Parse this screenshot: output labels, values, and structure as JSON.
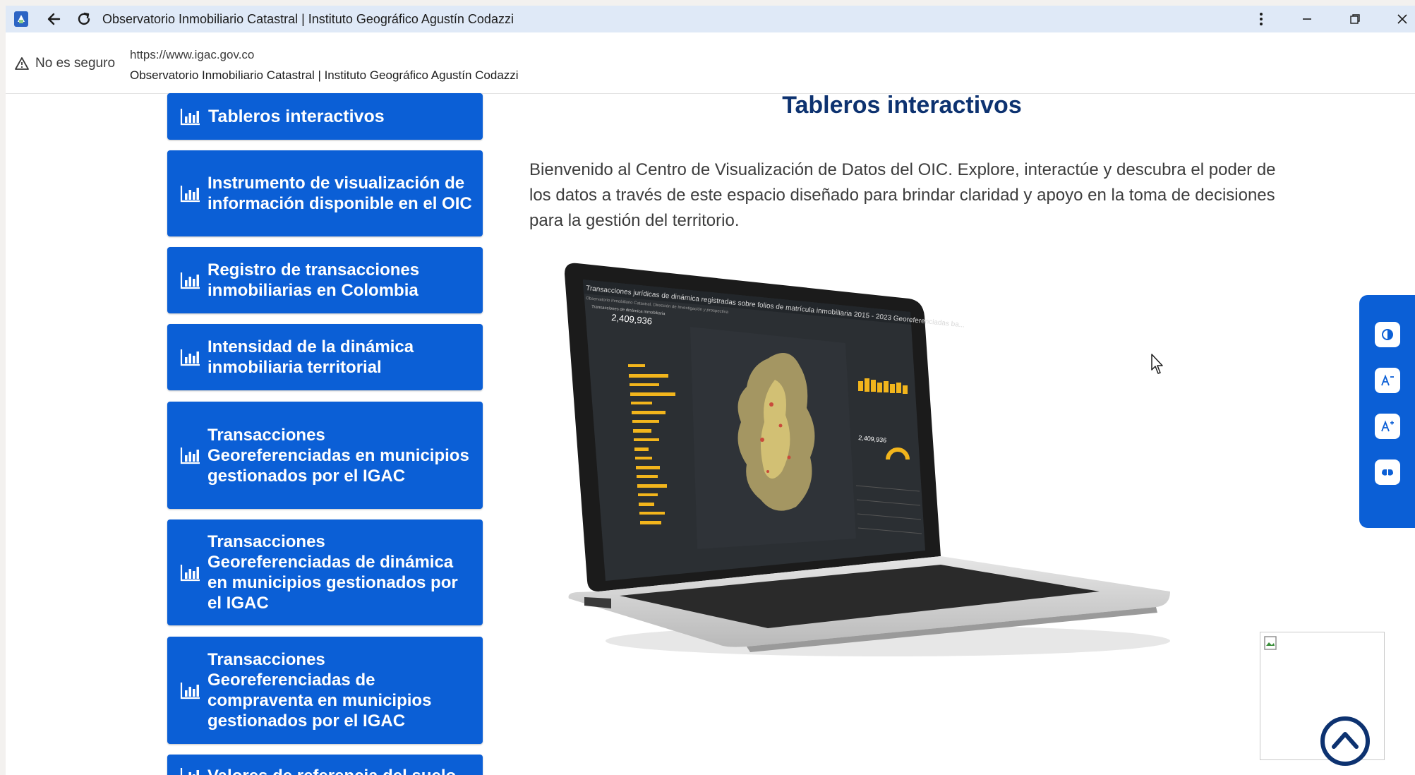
{
  "browser": {
    "title": "Observatorio Inmobiliario Catastral | Instituto Geográfico Agustín Codazzi",
    "security_label": "No es seguro",
    "url": "https://www.igac.gov.co",
    "page_title": "Observatorio Inmobiliario Catastral | Instituto Geográfico Agustín Codazzi"
  },
  "sidebar": {
    "items": [
      {
        "label": "Tableros interactivos"
      },
      {
        "label": "Instrumento de visualización de información disponible en el OIC"
      },
      {
        "label": "Registro de transacciones inmobiliarias en Colombia"
      },
      {
        "label": "Intensidad de la dinámica inmobiliaria territorial"
      },
      {
        "label": "Transacciones Georeferenciadas en municipios gestionados por el IGAC"
      },
      {
        "label": "Transacciones Georeferenciadas de dinámica en municipios gestionados por el IGAC"
      },
      {
        "label": "Transacciones Georeferenciadas de compraventa en municipios gestionados por el IGAC"
      },
      {
        "label": "Valores de referencia del suelo"
      }
    ]
  },
  "main": {
    "heading": "Tableros interactivos",
    "intro": "Bienvenido al Centro de Visualización de Datos del OIC. Explore, interactúe y descubra el poder de los datos a través de este espacio diseñado para brindar claridad y apoyo en la toma de decisiones para la gestión del territorio."
  },
  "dashboard_preview": {
    "title": "Transacciones jurídicas de dinámica registradas sobre folios de matrícula inmobiliaria 2015 - 2023 Georeferenciadas ba...",
    "subtitle": "Observatorio Inmobiliario Catastral, Dirección de Investigación y prospectiva",
    "panel_label": "Transacciones de dinámica inmobiliaria",
    "total": "2,409,936",
    "total_small": "2,409,936"
  },
  "accessibility": {
    "buttons": [
      "contrast-icon",
      "decrease-font-icon",
      "increase-font-icon",
      "sign-language-icon"
    ]
  },
  "colors": {
    "primary": "#0b5fd6",
    "heading": "#0d3270",
    "titlebar": "#dfe9f7"
  }
}
